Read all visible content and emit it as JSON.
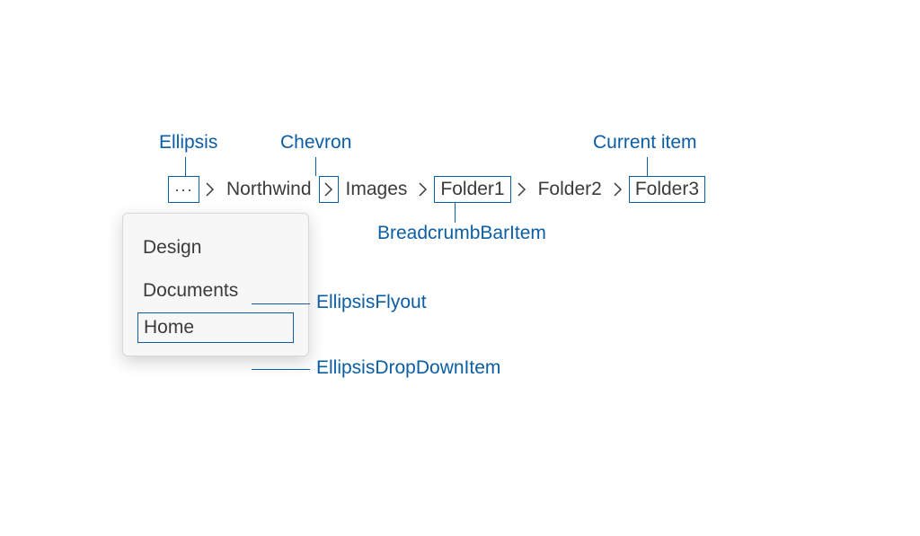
{
  "annotations": {
    "ellipsis": "Ellipsis",
    "chevron": "Chevron",
    "current_item": "Current item",
    "breadcrumb_bar_item": "BreadcrumbBarItem",
    "ellipsis_flyout": "EllipsisFlyout",
    "ellipsis_dropdown_item": "EllipsisDropDownItem"
  },
  "breadcrumb": {
    "ellipsis_glyph": "···",
    "items": [
      {
        "label": "Northwind"
      },
      {
        "label": "Images"
      },
      {
        "label": "Folder1"
      },
      {
        "label": "Folder2"
      },
      {
        "label": "Folder3"
      }
    ]
  },
  "flyout": {
    "items": [
      {
        "label": "Design"
      },
      {
        "label": "Documents"
      },
      {
        "label": "Home"
      }
    ]
  }
}
